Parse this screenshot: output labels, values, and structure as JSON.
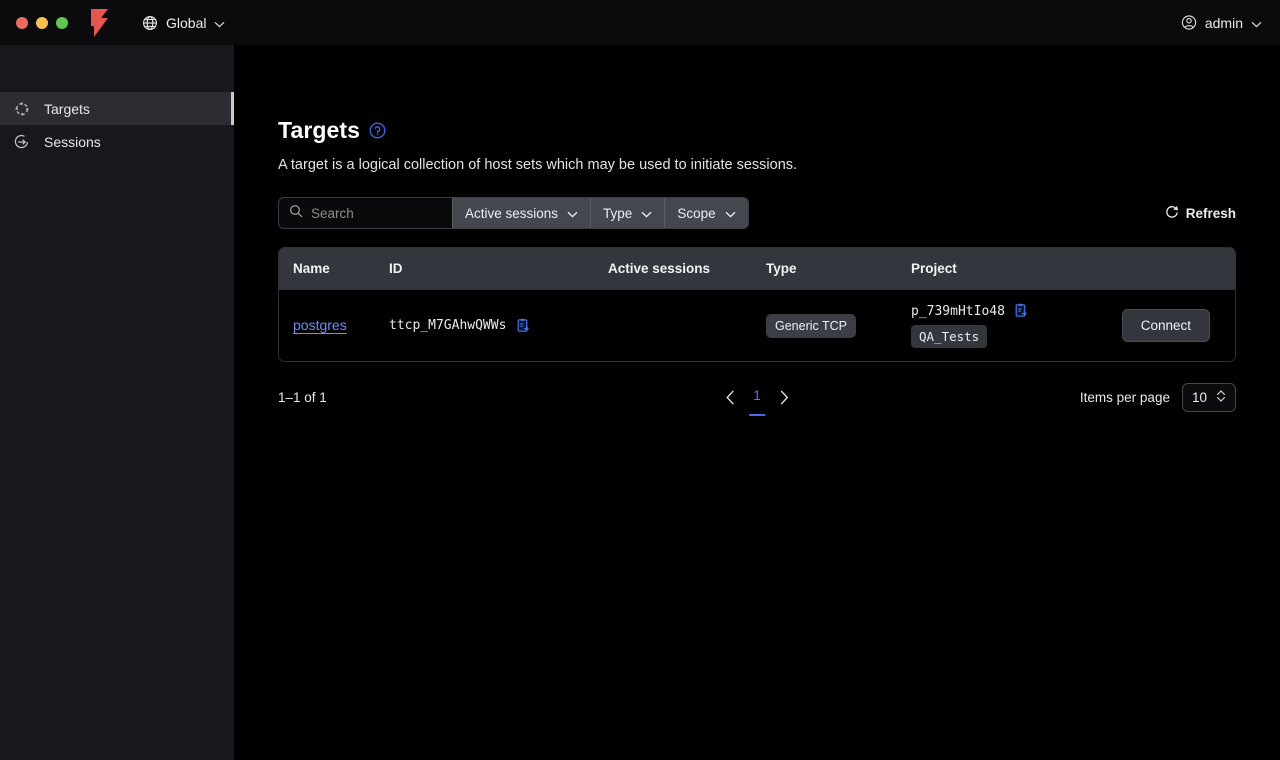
{
  "titlebar": {
    "scope_label": "Global",
    "scope_icon": "globe-icon",
    "user_label": "admin",
    "user_icon": "user-circle-icon",
    "logo_icon": "boundary-logo",
    "logo_color": "#e8554f"
  },
  "sidebar": {
    "items": [
      {
        "label": "Targets",
        "icon": "target-icon",
        "active": true
      },
      {
        "label": "Sessions",
        "icon": "session-icon",
        "active": false
      }
    ]
  },
  "main": {
    "title": "Targets",
    "help_icon": "help-circle-icon",
    "description": "A target is a logical collection of host sets which may be used to initiate sessions.",
    "toolbar": {
      "search_placeholder": "Search",
      "search_value": "",
      "search_icon": "search-icon",
      "filters": [
        {
          "label": "Active sessions"
        },
        {
          "label": "Type"
        },
        {
          "label": "Scope"
        }
      ],
      "refresh_label": "Refresh",
      "refresh_icon": "refresh-icon"
    },
    "table": {
      "columns": [
        "Name",
        "ID",
        "Active sessions",
        "Type",
        "Project"
      ],
      "rows": [
        {
          "name": "postgres",
          "id": "ttcp_M7GAhwQWWs",
          "id_copy_icon": "copy-icon",
          "active_sessions": "",
          "type": "Generic TCP",
          "project_id": "p_739mHtIo48",
          "project_copy_icon": "copy-icon",
          "project_name": "QA_Tests",
          "action_label": "Connect"
        }
      ]
    },
    "pagination": {
      "count_label": "1–1 of 1",
      "prev_icon": "chevron-left-icon",
      "next_icon": "chevron-right-icon",
      "current_page": "1",
      "items_per_page_label": "Items per page",
      "items_per_page_value": "10"
    }
  },
  "colors": {
    "accent_blue": "#5b7cf0",
    "brand_red": "#e8554f",
    "sidebar_bg": "#16181c",
    "content_bg": "#000000"
  }
}
